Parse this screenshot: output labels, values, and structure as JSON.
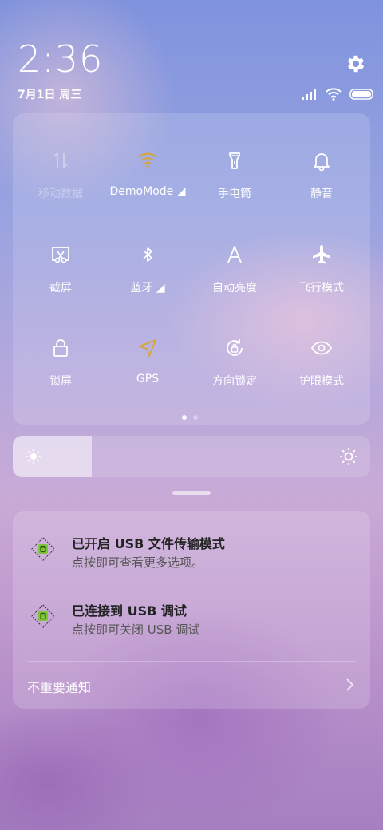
{
  "status": {
    "time": "2:36",
    "date": "7月1日 周三",
    "icons": [
      "signal-icon",
      "wifi-icon",
      "battery-icon"
    ]
  },
  "quick_settings": {
    "tiles": [
      {
        "label": "移动数据",
        "icon": "mobile-data-icon",
        "state": "off"
      },
      {
        "label": "DemoMode ◢",
        "icon": "wifi-icon",
        "state": "on-accent"
      },
      {
        "label": "手电筒",
        "icon": "flashlight-icon",
        "state": "normal"
      },
      {
        "label": "静音",
        "icon": "bell-icon",
        "state": "normal"
      },
      {
        "label": "截屏",
        "icon": "screenshot-icon",
        "state": "normal"
      },
      {
        "label": "蓝牙 ◢",
        "icon": "bluetooth-icon",
        "state": "normal"
      },
      {
        "label": "自动亮度",
        "icon": "auto-brightness-icon",
        "state": "normal"
      },
      {
        "label": "飞行模式",
        "icon": "airplane-icon",
        "state": "normal"
      },
      {
        "label": "锁屏",
        "icon": "lock-icon",
        "state": "normal"
      },
      {
        "label": "GPS",
        "icon": "gps-icon",
        "state": "on-accent"
      },
      {
        "label": "方向锁定",
        "icon": "rotation-lock-icon",
        "state": "normal"
      },
      {
        "label": "护眼模式",
        "icon": "eye-icon",
        "state": "normal"
      }
    ],
    "page_indicator": {
      "pages": 2,
      "current": 1
    }
  },
  "brightness": {
    "level": 0.22
  },
  "notifications": [
    {
      "title": "已开启 USB 文件传输模式",
      "body": "点按即可查看更多选项。",
      "icon": "android-debug-icon"
    },
    {
      "title": "已连接到 USB 调试",
      "body": "点按即可关闭 USB 调试",
      "icon": "android-debug-icon"
    }
  ],
  "unimportant": {
    "label": "不重要通知"
  },
  "colors": {
    "accent": "#d7a53a",
    "text_dark": "#222222",
    "text_muted": "#555555"
  }
}
